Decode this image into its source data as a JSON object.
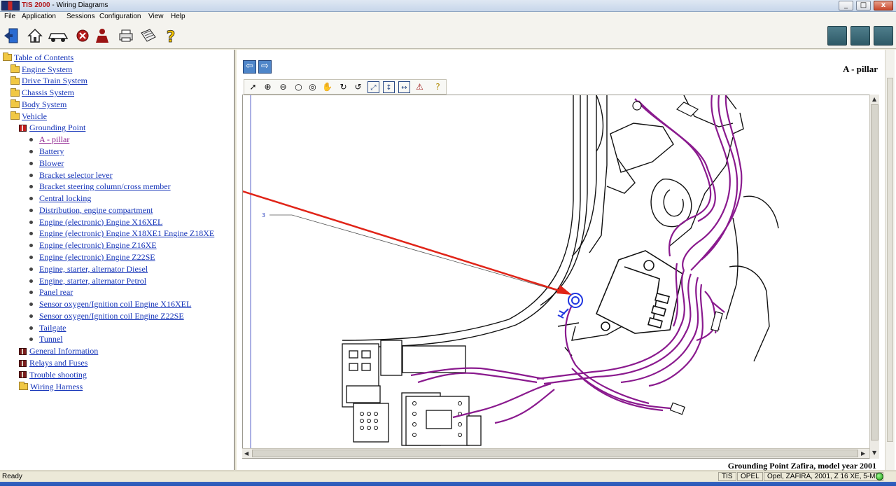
{
  "window": {
    "title_brand": "TIS 2000",
    "title_rest": " - Wiring Diagrams",
    "minimize": "_",
    "maximize": "□",
    "close": "x"
  },
  "menu": [
    "File",
    "Application",
    "Sessions",
    "Configuration",
    "View",
    "Help"
  ],
  "toolbar_icons": [
    "exit-icon",
    "home-icon",
    "vehicle-icon",
    "stop-icon",
    "person-icon",
    "printer-icon",
    "notepad-icon",
    "help-icon"
  ],
  "toolbar_right_icons": [
    "diagnostics-icon",
    "vehicle-data-icon",
    "vehicle-service-icon"
  ],
  "tree": {
    "root": "Table of Contents",
    "items": [
      {
        "label": "Engine System",
        "level": 1,
        "icon": "folder"
      },
      {
        "label": "Drive Train System",
        "level": 1,
        "icon": "folder"
      },
      {
        "label": "Chassis System",
        "level": 1,
        "icon": "folder"
      },
      {
        "label": "Body System",
        "level": 1,
        "icon": "folder"
      },
      {
        "label": "Vehicle",
        "level": 1,
        "icon": "folder-open"
      },
      {
        "label": "Grounding Point",
        "level": 2,
        "icon": "book-open"
      },
      {
        "label": "A - pillar",
        "level": 3,
        "icon": "bullet",
        "selected": true
      },
      {
        "label": "Battery",
        "level": 3,
        "icon": "bullet"
      },
      {
        "label": "Blower",
        "level": 3,
        "icon": "bullet"
      },
      {
        "label": "Bracket selector lever",
        "level": 3,
        "icon": "bullet"
      },
      {
        "label": "Bracket steering column/cross member",
        "level": 3,
        "icon": "bullet"
      },
      {
        "label": "Central locking",
        "level": 3,
        "icon": "bullet"
      },
      {
        "label": "Distribution, engine compartment",
        "level": 3,
        "icon": "bullet"
      },
      {
        "label": "Engine (electronic) Engine X16XEL",
        "level": 3,
        "icon": "bullet"
      },
      {
        "label": "Engine (electronic) Engine X18XE1 Engine Z18XE",
        "level": 3,
        "icon": "bullet"
      },
      {
        "label": "Engine (electronic) Engine Z16XE",
        "level": 3,
        "icon": "bullet"
      },
      {
        "label": "Engine (electronic) Engine Z22SE",
        "level": 3,
        "icon": "bullet"
      },
      {
        "label": "Engine, starter, alternator Diesel",
        "level": 3,
        "icon": "bullet"
      },
      {
        "label": "Engine, starter, alternator Petrol",
        "level": 3,
        "icon": "bullet"
      },
      {
        "label": "Panel rear",
        "level": 3,
        "icon": "bullet"
      },
      {
        "label": "Sensor oxygen/Ignition coil Engine X16XEL",
        "level": 3,
        "icon": "bullet"
      },
      {
        "label": "Sensor oxygen/Ignition coil Engine Z22SE",
        "level": 3,
        "icon": "bullet"
      },
      {
        "label": "Tailgate",
        "level": 3,
        "icon": "bullet"
      },
      {
        "label": "Tunnel",
        "level": 3,
        "icon": "bullet"
      },
      {
        "label": "General Information",
        "level": 2,
        "icon": "book"
      },
      {
        "label": "Relays and Fuses",
        "level": 2,
        "icon": "book"
      },
      {
        "label": "Trouble shooting",
        "level": 2,
        "icon": "book"
      },
      {
        "label": "Wiring Harness",
        "level": 2,
        "icon": "folder"
      }
    ]
  },
  "document": {
    "title": "A - pillar",
    "caption": "Grounding Point Zafira, model year 2001",
    "callout_label": "3",
    "nav_back": "⇦",
    "nav_forward": "⇨"
  },
  "viewer_tools": [
    "select-pointer-icon",
    "zoom-in-icon",
    "zoom-out-icon",
    "zoom-icon",
    "zoom-area-icon",
    "pan-hand-icon",
    "rotate-right-icon",
    "rotate-left-icon",
    "fit-page-icon",
    "fit-height-icon",
    "fit-width-icon",
    "antenna-icon",
    "help-icon"
  ],
  "status": {
    "ready": "Ready",
    "system": "TIS",
    "brand": "OPEL",
    "vehicle": "Opel, ZAFIRA, 2001, Z 16 XE, 5-MT"
  },
  "colors": {
    "link": "#1433b8",
    "link_visited": "#8b1a8b",
    "harness": "#8a1a8e",
    "ground_point": "#1f35e0",
    "annotation_arrow": "#e02418"
  }
}
